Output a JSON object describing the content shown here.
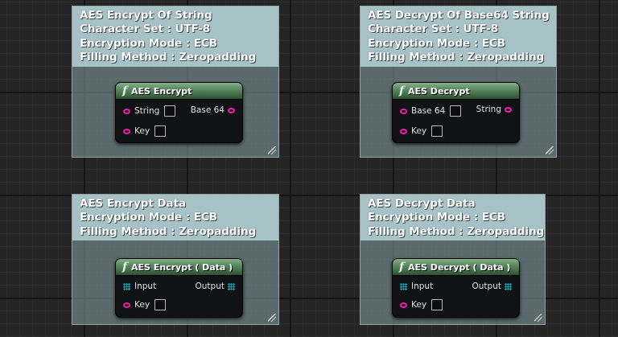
{
  "comments": [
    {
      "lines": [
        "AES Encrypt Of String",
        "Character Set : UTF-8",
        "Encryption Mode : ECB",
        "Filling Method : Zeropadding"
      ],
      "node": {
        "title": "AES Encrypt",
        "inputs": [
          {
            "label": "String",
            "pin": "string"
          },
          {
            "label": "Key",
            "pin": "string"
          }
        ],
        "outputs": [
          {
            "label": "Base 64",
            "pin": "string"
          }
        ]
      }
    },
    {
      "lines": [
        "AES Decrypt Of Base64 String",
        "Character Set : UTF-8",
        "Encryption Mode : ECB",
        "Filling Method : Zeropadding"
      ],
      "node": {
        "title": "AES Decrypt",
        "inputs": [
          {
            "label": "Base 64",
            "pin": "string"
          },
          {
            "label": "Key",
            "pin": "string"
          }
        ],
        "outputs": [
          {
            "label": "String",
            "pin": "string"
          }
        ]
      }
    },
    {
      "lines": [
        "AES Encrypt Data",
        "Encryption Mode : ECB",
        "Filling Method : Zeropadding"
      ],
      "node": {
        "title": "AES Encrypt ( Data )",
        "inputs": [
          {
            "label": "Input",
            "pin": "byte-array"
          },
          {
            "label": "Key",
            "pin": "string"
          }
        ],
        "outputs": [
          {
            "label": "Output",
            "pin": "byte-array"
          }
        ]
      }
    },
    {
      "lines": [
        "AES Decrypt Data",
        "Encryption Mode : ECB",
        "Filling Method : Zeropadding"
      ],
      "node": {
        "title": "AES Decrypt ( Data )",
        "inputs": [
          {
            "label": "Input",
            "pin": "byte-array"
          },
          {
            "label": "Key",
            "pin": "string"
          }
        ],
        "outputs": [
          {
            "label": "Output",
            "pin": "byte-array"
          }
        ]
      }
    }
  ],
  "colors": {
    "string_pin": "#ee1db0",
    "byte_array_pin": "#1aa5b3",
    "function_header": "#4f7d55",
    "comment_header": "#a7c2c6"
  },
  "icons": {
    "node_title_icon": "function-icon",
    "comment_corner_icon": "resize-grip-icon"
  }
}
